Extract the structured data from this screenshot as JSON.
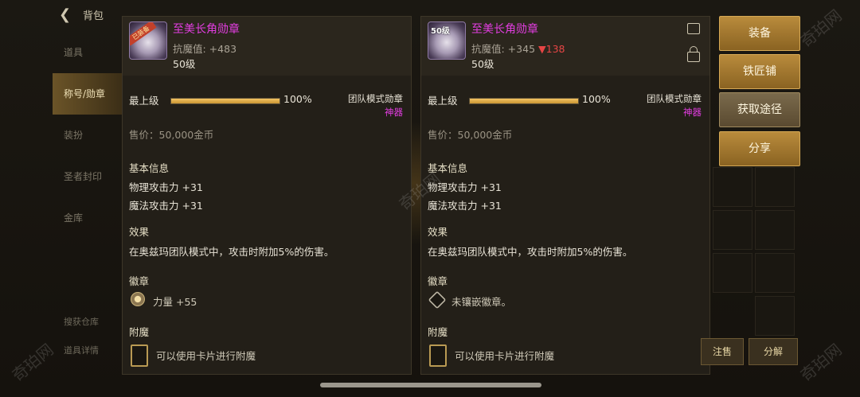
{
  "topbar": {
    "back_icon": "back-arrow-icon",
    "title": "背包"
  },
  "sidebar": {
    "items": [
      {
        "label": "道具"
      },
      {
        "label": "称号/勋章"
      },
      {
        "label": "装扮"
      },
      {
        "label": "圣者封印"
      },
      {
        "label": "金库"
      }
    ],
    "bottom": [
      {
        "label": "搜获仓库"
      },
      {
        "label": "道具详情"
      }
    ]
  },
  "panels": [
    {
      "item_name": "至美长角勋章",
      "ribbon": "已装备",
      "level_badge": "50级",
      "resist_label": "抗魔值: +483",
      "resist_diff": "",
      "level": "50级",
      "max_level_label": "最上级",
      "progress_pct": 100,
      "progress_text": "100%",
      "mode_tag": "团队模式勋章",
      "rarity": "神器",
      "price": "售价：50,000金币",
      "basic_title": "基本信息",
      "stat1": "物理攻击力 +31",
      "stat2": "魔法攻击力 +31",
      "effect_title": "效果",
      "effect_text": "在奥兹玛团队模式中，攻击时附加5%的伤害。",
      "emblem_title": "徽章",
      "emblem_text": "力量 +55",
      "enchant_title": "附魔",
      "enchant_text": "可以使用卡片进行附魔"
    },
    {
      "item_name": "至美长角勋章",
      "ribbon": "",
      "level_badge": "50级",
      "resist_label": "抗魔值: +345",
      "resist_diff": "▼138",
      "level": "50级",
      "max_level_label": "最上级",
      "progress_pct": 100,
      "progress_text": "100%",
      "mode_tag": "团队模式勋章",
      "rarity": "神器",
      "price": "售价：50,000金币",
      "basic_title": "基本信息",
      "stat1": "物理攻击力 +31",
      "stat2": "魔法攻击力 +31",
      "effect_title": "效果",
      "effect_text": "在奥兹玛团队模式中，攻击时附加5%的伤害。",
      "emblem_title": "徽章",
      "emblem_text": "未镶嵌徽章。",
      "enchant_title": "附魔",
      "enchant_text": "可以使用卡片进行附魔"
    }
  ],
  "actions": {
    "equip": "装备",
    "blacksmith": "铁匠铺",
    "obtain": "获取途径",
    "share": "分享",
    "register": "注售",
    "decompose": "分解"
  },
  "watermark": "奇珀网",
  "colors": {
    "rarity": "#e23de0",
    "diff_down": "#e64545",
    "button": "#b98b3c"
  }
}
